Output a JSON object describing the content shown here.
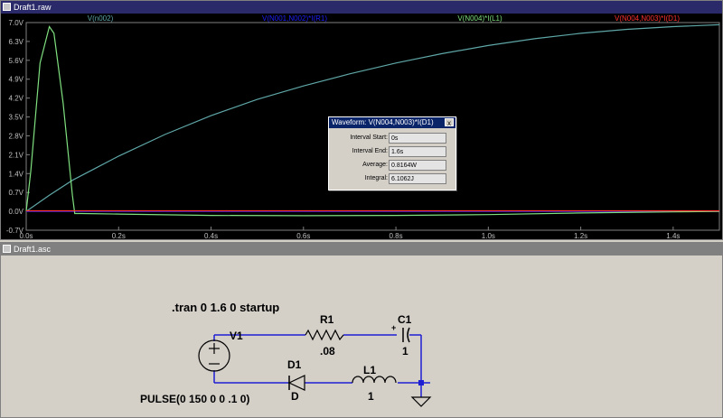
{
  "plot_window": {
    "title": "Draft1.raw",
    "traces": [
      {
        "label": "V(n002)",
        "color": "#5fa6a6"
      },
      {
        "label": "V(N001,N002)*I(R1)",
        "color": "#1e1eff"
      },
      {
        "label": "V(N004)*I(L1)",
        "color": "#7fe07f"
      },
      {
        "label": "V(N004,N003)*I(D1)",
        "color": "#ff3030"
      }
    ],
    "y_ticks": [
      "7.0V",
      "6.3V",
      "5.6V",
      "4.9V",
      "4.2V",
      "3.5V",
      "2.8V",
      "2.1V",
      "1.4V",
      "0.7V",
      "0.0V",
      "-0.7V"
    ],
    "x_ticks": [
      "0.0s",
      "0.2s",
      "0.4s",
      "0.6s",
      "0.8s",
      "1.0s",
      "1.2s",
      "1.4s"
    ]
  },
  "chart_data": {
    "type": "line",
    "xlabel": "",
    "ylabel": "",
    "xlim": [
      0,
      1.5
    ],
    "ylim": [
      -0.7,
      7.0
    ],
    "grid": false,
    "series": [
      {
        "name": "V(n002)",
        "color": "#5fa6a6",
        "x": [
          0,
          0.05,
          0.1,
          0.15,
          0.2,
          0.3,
          0.4,
          0.5,
          0.6,
          0.7,
          0.8,
          0.9,
          1.0,
          1.1,
          1.2,
          1.3,
          1.4,
          1.5
        ],
        "y": [
          0,
          0.6,
          1.15,
          1.6,
          2.05,
          2.85,
          3.55,
          4.15,
          4.65,
          5.1,
          5.5,
          5.85,
          6.15,
          6.4,
          6.6,
          6.75,
          6.85,
          6.92
        ]
      },
      {
        "name": "V(N001,N002)*I(R1)",
        "color": "#1e1eff",
        "x": [
          0,
          1.5
        ],
        "y": [
          0,
          0
        ]
      },
      {
        "name": "V(N004)*I(L1)",
        "color": "#7fe07f",
        "x": [
          0,
          0.01,
          0.03,
          0.05,
          0.06,
          0.08,
          0.1,
          0.105,
          0.12,
          0.2,
          0.4,
          0.6,
          0.8,
          1.0,
          1.2,
          1.4,
          1.5
        ],
        "y": [
          0,
          1.5,
          5.5,
          6.85,
          6.6,
          4.0,
          0.6,
          -0.08,
          -0.08,
          -0.1,
          -0.15,
          -0.16,
          -0.15,
          -0.12,
          -0.06,
          -0.02,
          0
        ]
      },
      {
        "name": "V(N004,N003)*I(D1)",
        "color": "#ff3030",
        "x": [
          0,
          1.5
        ],
        "y": [
          0.02,
          0.02
        ]
      }
    ]
  },
  "dialog": {
    "title": "Waveform: V(N004,N003)*I(D1)",
    "close": "x",
    "rows": [
      {
        "label": "Interval Start:",
        "value": "0s"
      },
      {
        "label": "Interval End:",
        "value": "1.6s"
      },
      {
        "label": "Average:",
        "value": "0.8164W"
      },
      {
        "label": "Integral:",
        "value": "6.1062J"
      }
    ]
  },
  "schematic_window": {
    "title": "Draft1.asc",
    "directive": ".tran 0 1.6 0 startup",
    "v1_name": "V1",
    "v1_value": "PULSE(0 150 0 0 .1 0)",
    "r1_name": "R1",
    "r1_value": ".08",
    "c1_name": "C1",
    "c1_value": "1",
    "d1_name": "D1",
    "d1_value": "D",
    "l1_name": "L1",
    "l1_value": "1",
    "plus_sign": "+"
  }
}
